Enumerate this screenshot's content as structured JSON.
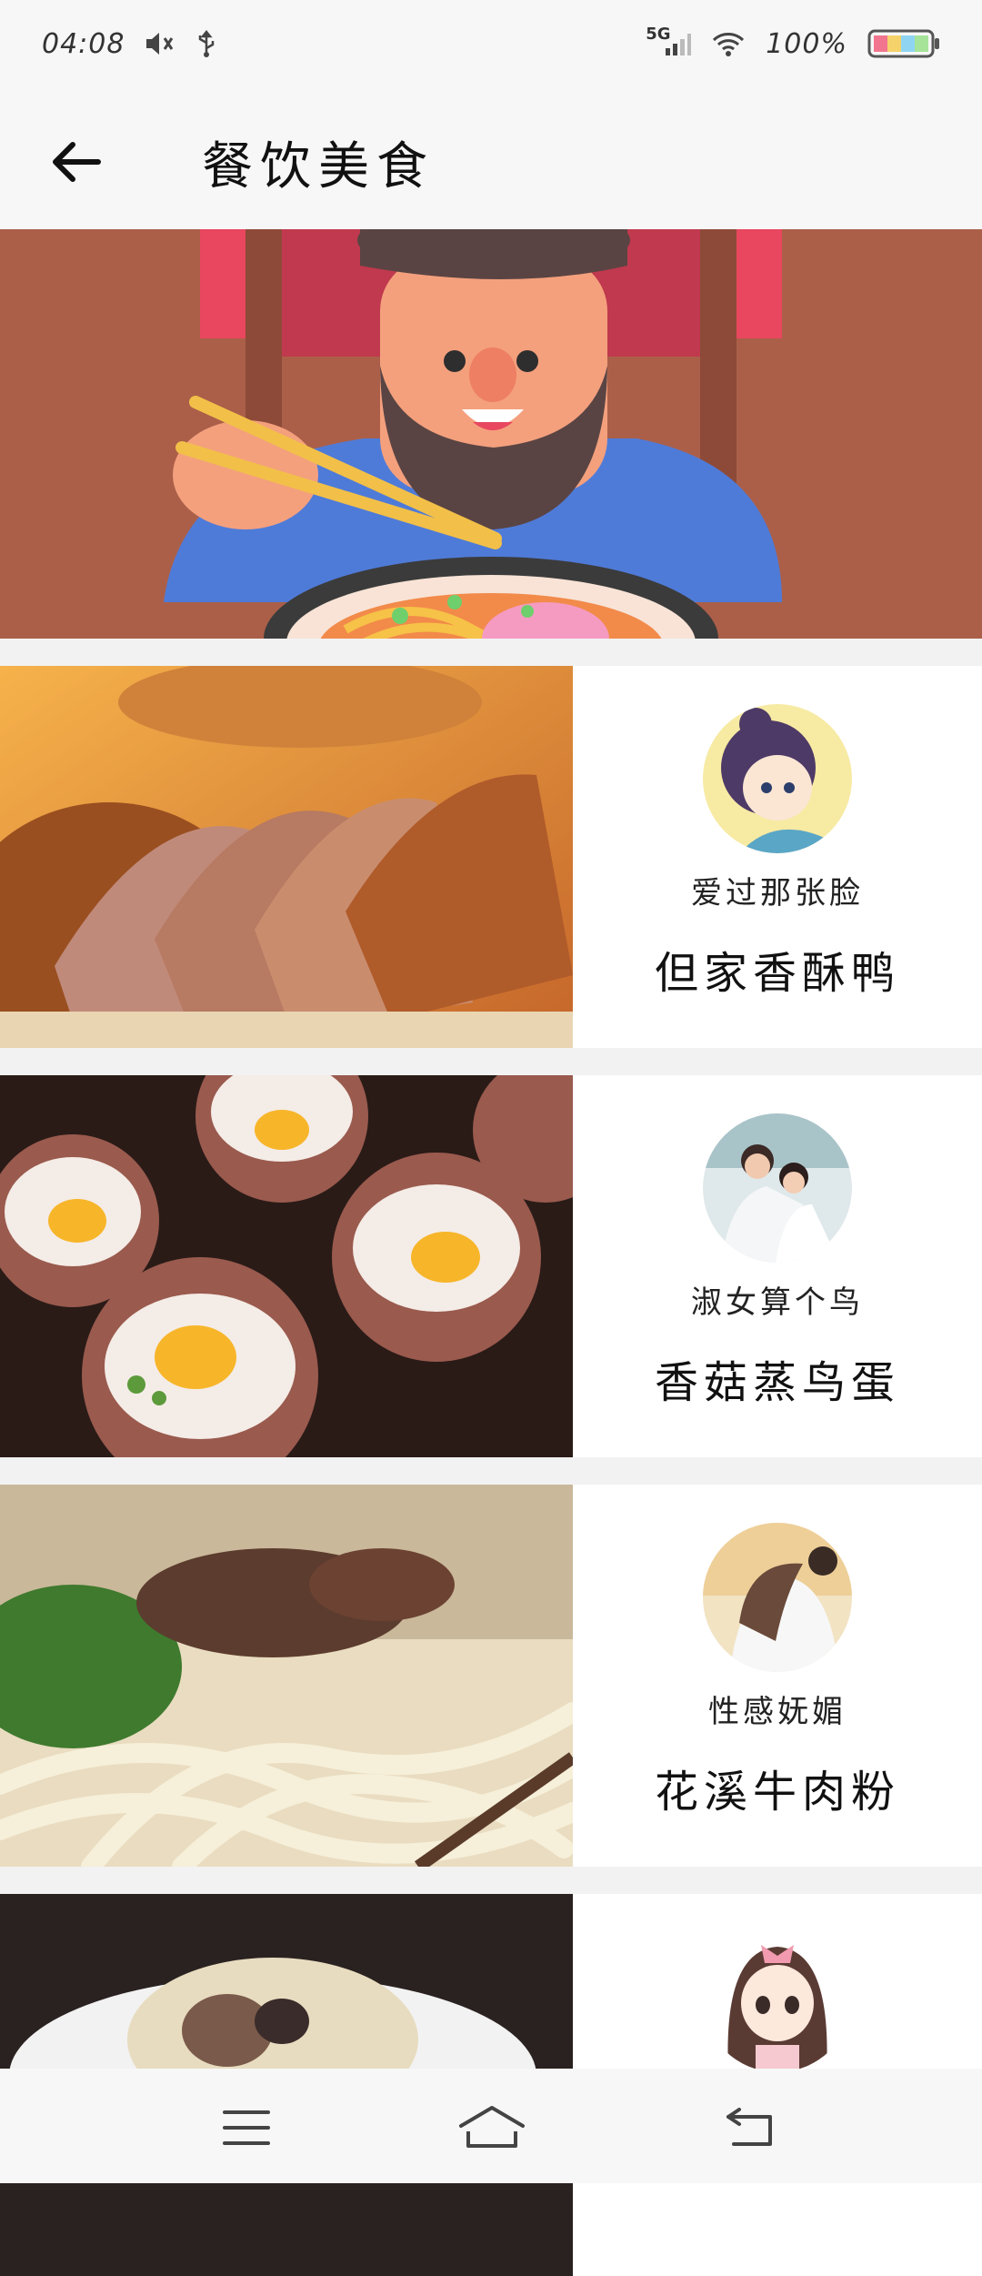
{
  "status_bar": {
    "time": "04:08",
    "network": "5G",
    "battery": "100%",
    "icons": [
      "mute-icon",
      "usb-icon",
      "signal-icon",
      "wifi-icon",
      "battery-icon"
    ]
  },
  "header": {
    "title": "餐饮美食",
    "back_icon": "arrow-left-icon"
  },
  "banner": {
    "image": "bearded-man-eating-noodles-illustration"
  },
  "items": [
    {
      "author": "爱过那张脸",
      "dish": "但家香酥鸭",
      "image": "roast-duck-photo",
      "avatar": "cartoon-girl-avatar"
    },
    {
      "author": "淑女算个鸟",
      "dish": "香菇蒸鸟蛋",
      "image": "mushroom-quail-egg-photo",
      "avatar": "couple-avatar"
    },
    {
      "author": "性感妩媚",
      "dish": "花溪牛肉粉",
      "image": "beef-noodle-photo",
      "avatar": "couple-hug-avatar"
    },
    {
      "author": "",
      "dish": "",
      "image": "dumpling-photo",
      "avatar": "anime-girl-avatar"
    }
  ],
  "nav": {
    "menu_icon": "menu-icon",
    "home_icon": "home-icon",
    "back_icon": "return-icon"
  },
  "colors": {
    "background": "#f2f2f2",
    "card": "#ffffff",
    "banner": "#ab5f49",
    "text": "#111111"
  }
}
